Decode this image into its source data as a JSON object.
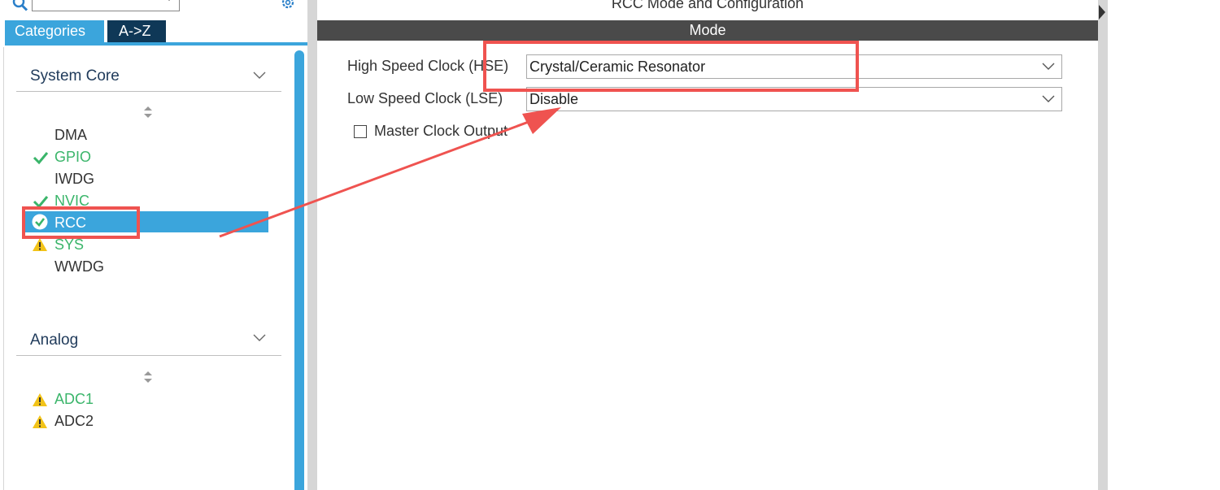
{
  "left_panel": {
    "search": {
      "value": "",
      "placeholder": ""
    },
    "tabs": [
      {
        "label": "Categories",
        "active": true
      },
      {
        "label": "A->Z",
        "active": false
      }
    ],
    "categories": [
      {
        "name": "System Core",
        "items": [
          {
            "label": "DMA",
            "status": "none"
          },
          {
            "label": "GPIO",
            "status": "ok"
          },
          {
            "label": "IWDG",
            "status": "none"
          },
          {
            "label": "NVIC",
            "status": "ok"
          },
          {
            "label": "RCC",
            "status": "ok-selected",
            "selected": true
          },
          {
            "label": "SYS",
            "status": "warning"
          },
          {
            "label": "WWDG",
            "status": "none"
          }
        ]
      },
      {
        "name": "Analog",
        "items": [
          {
            "label": "ADC1",
            "status": "warning"
          },
          {
            "label": "ADC2",
            "status": "warning"
          }
        ]
      }
    ]
  },
  "right_panel": {
    "title": "RCC Mode and Configuration",
    "section": "Mode",
    "fields": [
      {
        "label": "High Speed Clock (HSE)",
        "value": "Crystal/Ceramic Resonator"
      },
      {
        "label": "Low Speed Clock (LSE)",
        "value": "Disable"
      }
    ],
    "checkbox": {
      "label": "Master Clock Output",
      "checked": false
    }
  },
  "colors": {
    "accent_blue": "#3ba5dc",
    "tab_dark": "#0f3857",
    "mode_bar": "#4a4a4a",
    "ok_green": "#3ab56a",
    "warning_yellow": "#f2c318",
    "annotation_red": "#ef5350"
  }
}
